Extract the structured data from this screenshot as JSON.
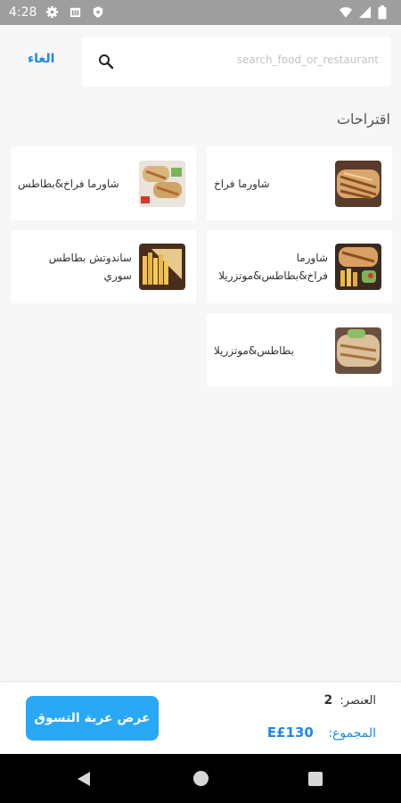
{
  "status_bar": {
    "time": "4:28",
    "icons": [
      "gear-icon",
      "sim-icon",
      "shield-icon",
      "wifi-icon",
      "signal-icon",
      "battery-icon"
    ]
  },
  "header": {
    "search_placeholder": "search_food_or_restaurant",
    "cancel_label": "الغاء"
  },
  "suggestions": {
    "title": "اقتراحات",
    "items": [
      {
        "label": "شاورما فراخ"
      },
      {
        "label": "شاورما فراخ&بطاطس"
      },
      {
        "label": "شاورما فراخ&بطاطس&موتزريلا"
      },
      {
        "label": "ساندوتش بطاطس سوري"
      },
      {
        "label": "بطاطس&موتزريلا"
      }
    ]
  },
  "cart": {
    "items_label": "العنصر:",
    "items_count": "2",
    "total_label": "المجموع:",
    "total_amount": "E£130",
    "button_label": "عرض عربة التسوق"
  },
  "colors": {
    "accent": "#1e88e5",
    "button": "#29a8f5",
    "status_bar": "#9e9e9e"
  }
}
